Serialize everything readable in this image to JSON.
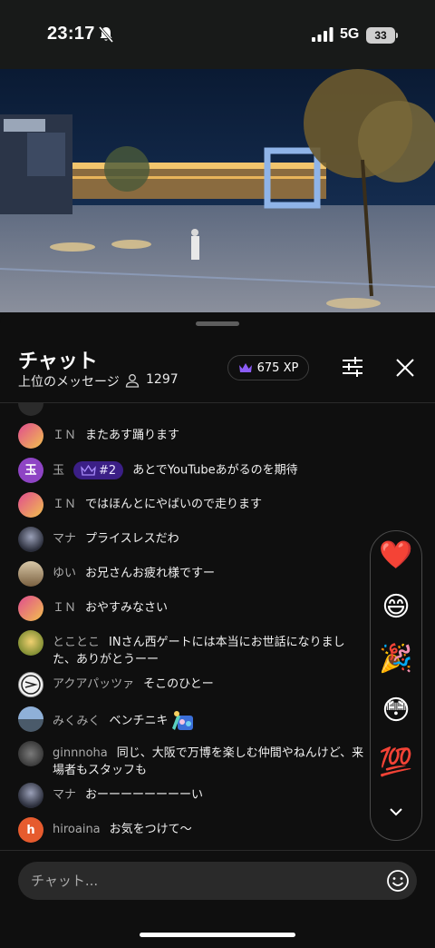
{
  "status_bar": {
    "time": "23:17",
    "network": "5G",
    "battery": "33"
  },
  "chat": {
    "title": "チャット",
    "mode": "上位のメッセージ",
    "viewer_count": "1297",
    "xp": "675 XP",
    "input_placeholder": "チャット..."
  },
  "messages": [
    {
      "author": "ＩＮ",
      "text": "またあす踊ります"
    },
    {
      "avatar_letter": "玉",
      "author": "玉",
      "badge": "#2",
      "text": "あとでYouTubeあがるのを期待"
    },
    {
      "author": "ＩＮ",
      "text": "ではほんとにやばいので走ります"
    },
    {
      "author": "マナ",
      "text": "プライスレスだわ"
    },
    {
      "author": "ゆい",
      "text": "お兄さんお疲れ様ですー"
    },
    {
      "author": "ＩＮ",
      "text": "おやすみなさい"
    },
    {
      "author": "とことこ",
      "text": "INさん西ゲートには本当にお世話になりました、ありがとうーー"
    },
    {
      "author": "アクアパッツァ",
      "text": "そこのひとー"
    },
    {
      "author": "みくみく",
      "text": "ベンチニキ"
    },
    {
      "author": "ginnnoha",
      "text": "同じ、大阪で万博を楽しむ仲間やねんけど、来場者もスタッフも"
    },
    {
      "author": "マナ",
      "text": "おーーーーーーーーい"
    },
    {
      "avatar_letter": "h",
      "author": "hiroaina",
      "text": "お気をつけて〜"
    }
  ],
  "reactions": [
    "❤️",
    "😄",
    "🎉",
    "😳",
    "💯"
  ],
  "colors": {
    "badge_bg": "#3b1f86",
    "accent_purple": "#8b5cf6",
    "background": "#0f0f0f"
  }
}
